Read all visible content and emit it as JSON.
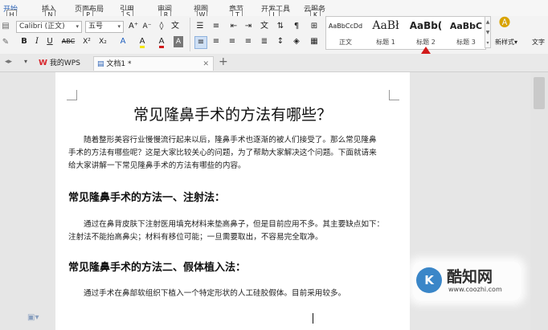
{
  "menu": {
    "tabs": [
      "开始",
      "插入",
      "页面布局",
      "引用",
      "审阅",
      "视图",
      "章节",
      "开发工具",
      "云服务"
    ],
    "keytips": [
      "H",
      "N",
      "P",
      "S",
      "R",
      "W",
      "T",
      "L",
      "K"
    ]
  },
  "toolbar": {
    "font_name": "Calibri (正文)",
    "font_size": "五号",
    "bold": "B",
    "italic": "I",
    "underline": "U",
    "strike": "ABC",
    "superscript": "X²",
    "subscript": "X₂",
    "font_color": "A",
    "highlight": "A",
    "new_style_label": "新样式",
    "text_tools_label": "文字"
  },
  "styles": [
    {
      "sample": "AaBbCcDd",
      "name": "正文"
    },
    {
      "sample": "AaBł",
      "name": "标题 1"
    },
    {
      "sample": "AaBb(",
      "name": "标题 2"
    },
    {
      "sample": "AaBbC",
      "name": "标题 3"
    }
  ],
  "tabs": {
    "wps_home": "我的WPS",
    "document": "文档1 *"
  },
  "document": {
    "title": "常见隆鼻手术的方法有哪些？",
    "intro_lines": [
      "随着整形美容行业慢慢流行起来以后，隆鼻手术也逐渐的被人们接受了。那么常见隆鼻",
      "手术的方法有哪些呢？这是大家比较关心的问题，为了帮助大家解决这个问题。下面就请来",
      "给大家讲解一下常见隆鼻手术的方法有哪些的内容。"
    ],
    "heading1": "常见隆鼻手术的方法一、注射法：",
    "para1_lines": [
      "通过在鼻背皮肤下注射医用填充材料来垫高鼻子，但是目前应用不多。其主要缺点如下：",
      "注射法不能抬高鼻尖；材料有移位可能；一旦需要取出，不容易完全取净。"
    ],
    "heading2": "常见隆鼻手术的方法二、假体植入法：",
    "para2_lines": [
      "通过手术在鼻部软组织下植入一个特定形状的人工硅胶假体。目前采用较多。"
    ]
  },
  "watermark": {
    "brand": "酷知网",
    "url": "www.coozhi.com"
  },
  "colors": {
    "accent_blue": "#2b62b6",
    "annotation_red": "#d11a1a",
    "wps_red": "#d8262c"
  }
}
